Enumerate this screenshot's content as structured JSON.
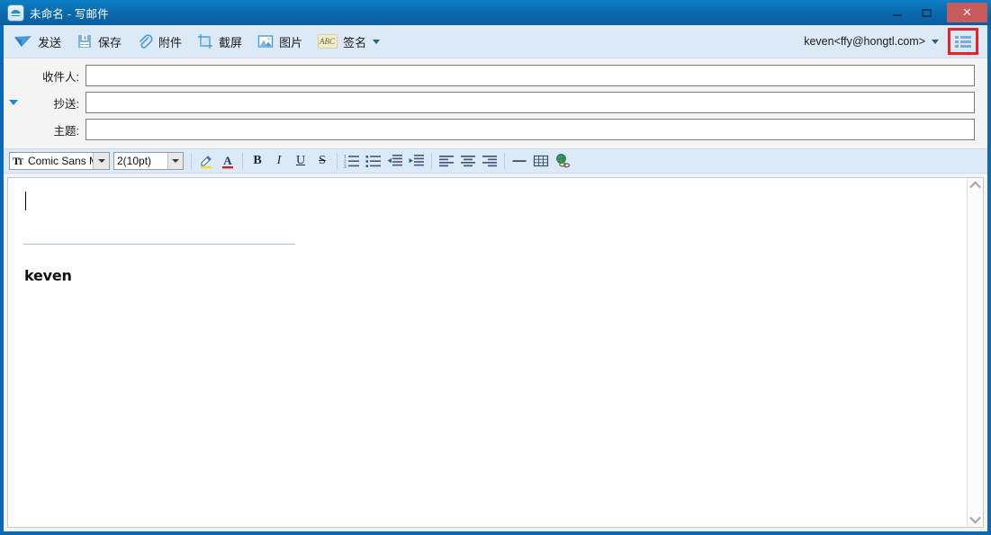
{
  "window": {
    "title": "未命名 - 写邮件",
    "app_icon": "cloud-mail-icon",
    "controls": {
      "minimize": "minimize-icon",
      "maximize": "maximize-icon",
      "close": "✕"
    },
    "accent_blue": "#0a68b4",
    "titlebar_blue": "#0b6cb0",
    "close_red": "#c75b5b"
  },
  "toolbar": {
    "items": [
      {
        "label": "发送",
        "icon": "send-paper-plane-icon"
      },
      {
        "label": "保存",
        "icon": "save-floppy-icon"
      },
      {
        "label": "附件",
        "icon": "attachment-paperclip-icon"
      },
      {
        "label": "截屏",
        "icon": "screenshot-crop-icon"
      },
      {
        "label": "图片",
        "icon": "image-picture-icon"
      },
      {
        "label": "签名",
        "icon": "signature-abc-icon",
        "has_dropdown": true
      }
    ],
    "account": "keven<ffy@hongtl.com>",
    "account_dropdown": "chevron-down-icon",
    "menu_icon": "hamburger-list-icon",
    "menu_highlight_color": "#f42020"
  },
  "fields": {
    "to": {
      "label": "收件人:",
      "value": "",
      "placeholder": ""
    },
    "cc": {
      "label": "抄送:",
      "value": "",
      "placeholder": "",
      "expander": "triangle-down-icon"
    },
    "subject": {
      "label": "主题:",
      "value": "",
      "placeholder": ""
    }
  },
  "formatbar": {
    "font_name": "Comic Sans M",
    "font_size": "2(10pt)",
    "buttons": [
      {
        "name": "highlight-pen",
        "glyph": ""
      },
      {
        "name": "font-color",
        "glyph": "A"
      },
      {
        "name": "bold",
        "glyph": "B"
      },
      {
        "name": "italic",
        "glyph": "I"
      },
      {
        "name": "underline",
        "glyph": "U"
      },
      {
        "name": "strikethrough",
        "glyph": "S"
      },
      {
        "name": "numbered-list",
        "glyph": ""
      },
      {
        "name": "bulleted-list",
        "glyph": ""
      },
      {
        "name": "decrease-indent",
        "glyph": ""
      },
      {
        "name": "increase-indent",
        "glyph": ""
      },
      {
        "name": "align-left",
        "glyph": ""
      },
      {
        "name": "align-center",
        "glyph": ""
      },
      {
        "name": "align-right",
        "glyph": ""
      },
      {
        "name": "horizontal-rule",
        "glyph": ""
      },
      {
        "name": "insert-table",
        "glyph": ""
      },
      {
        "name": "insert-hyperlink",
        "glyph": ""
      }
    ]
  },
  "editor": {
    "body_text": "",
    "signature_name": "keven",
    "scrollbar": {
      "up": "chevron-up-icon",
      "down": "chevron-down-icon"
    }
  }
}
